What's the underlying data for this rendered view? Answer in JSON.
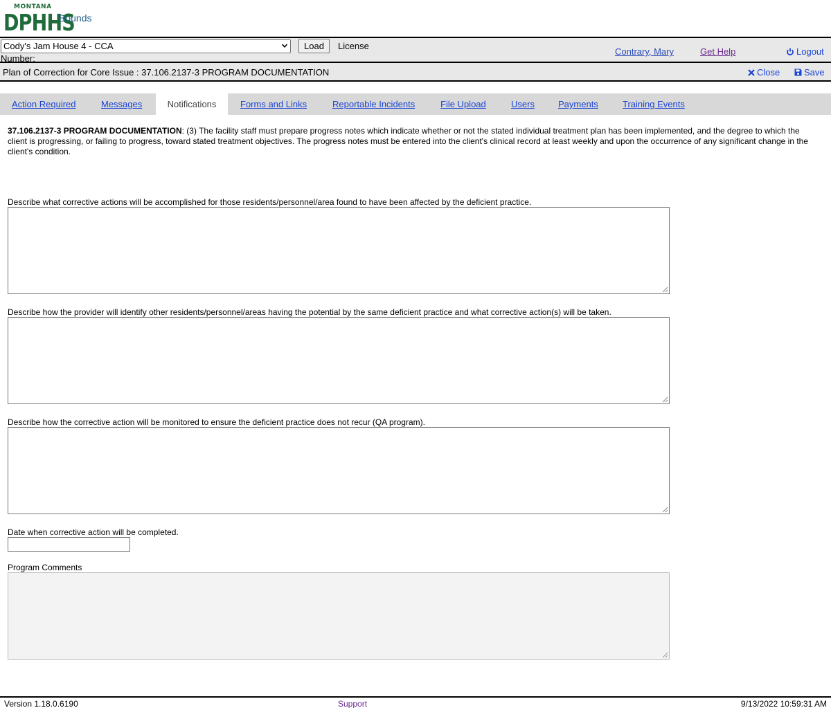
{
  "header": {
    "logo_top": "MONTANA",
    "logo_main": "DPHHS",
    "app_name": "Bounds"
  },
  "license_bar": {
    "selected_license": "Cody's Jam House 4 - CCA",
    "load_label": "Load",
    "license_label": "License",
    "number_label": "Number:",
    "user_name": "Contrary, Mary",
    "help_label": "Get Help",
    "logout_label": "Logout"
  },
  "title_bar": {
    "title": "Plan of Correction for Core Issue : 37.106.2137-3 PROGRAM DOCUMENTATION",
    "close_label": "Close",
    "save_label": "Save"
  },
  "tabs": [
    {
      "label": "Action Required",
      "active": false
    },
    {
      "label": "Messages",
      "active": false
    },
    {
      "label": "Notifications",
      "active": true
    },
    {
      "label": "Forms and Links",
      "active": false
    },
    {
      "label": "Reportable Incidents",
      "active": false
    },
    {
      "label": "File Upload",
      "active": false
    },
    {
      "label": "Users",
      "active": false
    },
    {
      "label": "Payments",
      "active": false
    },
    {
      "label": "Training Events",
      "active": false
    }
  ],
  "issue": {
    "code": "37.106.2137-3 PROGRAM DOCUMENTATION",
    "text": ": (3) The facility staff must prepare progress notes which indicate whether or not the stated individual treatment plan has been implemented, and the degree to which the client is progressing, or failing to progress, toward stated treatment objectives. The progress notes must be entered into the client's clinical record at least weekly and upon the occurrence of any significant change in the client's condition."
  },
  "form": {
    "q1_label": "Describe what corrective actions will be accomplished for those residents/personnel/area found to have been affected by the deficient practice.",
    "q1_value": "",
    "q2_label": "Describe how the provider will identify other residents/personnel/areas having the potential by the same deficient practice and what corrective action(s) will be taken.",
    "q2_value": "",
    "q3_label": "Describe how the corrective action will be monitored to ensure the deficient practice does not recur (QA program).",
    "q3_value": "",
    "date_label": "Date when corrective action will be completed.",
    "date_value": "",
    "comments_label": "Program Comments",
    "comments_value": ""
  },
  "footer": {
    "version": "Version 1.18.0.6190",
    "support": "Support",
    "timestamp": "9/13/2022 10:59:31 AM"
  },
  "colors": {
    "logo_green": "#1f6b3a",
    "link_blue": "#1a44d6",
    "visited_purple": "#6b2d8e",
    "bar_gray": "#e8e8e8",
    "tab_gray": "#d8d8d8"
  }
}
